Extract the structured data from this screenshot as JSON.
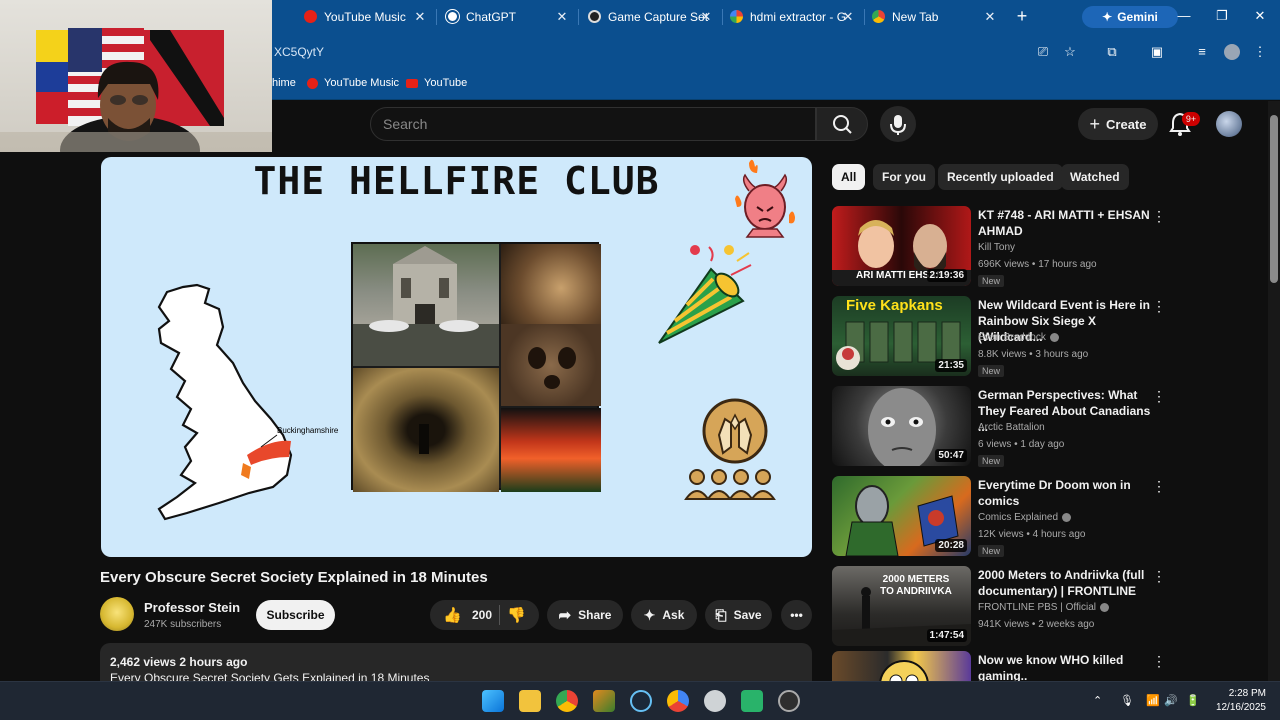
{
  "browser": {
    "tabs": [
      {
        "label": "YouTube Music",
        "color": "#e62117"
      },
      {
        "label": "ChatGPT",
        "color": "#ffffff"
      },
      {
        "label": "Game Capture Set",
        "color": "#cfcfcf"
      },
      {
        "label": "hdmi extractor - G",
        "color": "#4285f4"
      },
      {
        "label": "New Tab",
        "color": "#ffffff"
      }
    ],
    "gemini_label": "Gemini",
    "url": "XC5QytY",
    "bookmarks": [
      "hime",
      "YouTube Music",
      "YouTube"
    ]
  },
  "youtube": {
    "search_placeholder": "Search",
    "create_label": "Create",
    "notif_badge": "9+",
    "chips": [
      "All",
      "For you",
      "Recently uploaded",
      "Watched"
    ],
    "video": {
      "art_title": "THE HELLFIRE CLUB",
      "map_label": "Buckinghamshire",
      "title": "Every Obscure Secret Society Explained in 18 Minutes",
      "channel": "Professor Stein",
      "subscribers": "247K subscribers",
      "subscribe_label": "Subscribe",
      "likes": "200",
      "share_label": "Share",
      "ask_label": "Ask",
      "save_label": "Save",
      "views_time": "2,462 views  2 hours ago",
      "description_line": "Every Obscure Secret Society Gets Explained in 18 Minutes"
    },
    "recommendations": [
      {
        "title": "KT #748 - ARI MATTI + EHSAN AHMAD",
        "channel": "Kill Tony",
        "meta": "696K views • 17 hours ago",
        "badge": "New",
        "duration": "2:19:36"
      },
      {
        "title": "New Wildcard Event is Here in Rainbow Six Siege X (Wildcard...",
        "channel": "Evan Braddock",
        "meta": "8.8K views • 3 hours ago",
        "badge": "New",
        "duration": "21:35"
      },
      {
        "title": "German Perspectives: What They Feared About Canadians ...",
        "channel": "Arctic Battalion",
        "meta": "6 views • 1 day ago",
        "badge": "New",
        "duration": "50:47"
      },
      {
        "title": "Everytime Dr Doom won in comics",
        "channel": "Comics Explained",
        "meta": "12K views • 4 hours ago",
        "badge": "New",
        "duration": "20:28"
      },
      {
        "title": "2000 Meters to Andriivka (full documentary) | FRONTLINE",
        "channel": "FRONTLINE PBS | Official",
        "meta": "941K views • 2 weeks ago",
        "badge": "",
        "duration": "1:47:54"
      },
      {
        "title": "Now we know WHO killed gaming..",
        "channel": "",
        "meta": "",
        "badge": "",
        "duration": ""
      }
    ],
    "thumb_texts": {
      "r0": "ARI MATTI  EHSAN",
      "r1": "Five Kapkans",
      "r4": "2000 METERS TO ANDRIIVKA"
    }
  },
  "taskbar": {
    "time": "2:28 PM",
    "date": "12/16/2025"
  }
}
